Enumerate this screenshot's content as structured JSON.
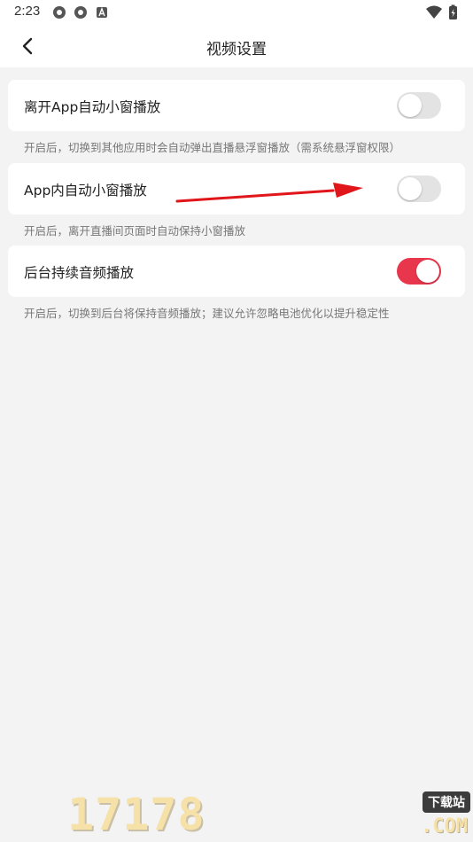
{
  "status_bar": {
    "time": "2:23"
  },
  "header": {
    "title": "视频设置"
  },
  "settings": [
    {
      "label": "离开App自动小窗播放",
      "enabled": false,
      "description": "开启后，切换到其他应用时会自动弹出直播悬浮窗播放（需系统悬浮窗权限）"
    },
    {
      "label": "App内自动小窗播放",
      "enabled": false,
      "description": "开启后，离开直播间页面时自动保持小窗播放"
    },
    {
      "label": "后台持续音频播放",
      "enabled": true,
      "description": "开启后，切换到后台将保持音频播放；建议允许忽略电池优化以提升稳定性"
    }
  ],
  "colors": {
    "toggle_on": "#e8374d",
    "toggle_off": "#e3e3e3",
    "annotation_arrow": "#e0161b"
  },
  "watermark": {
    "numbers": "17178",
    "badge": "下载站",
    "domain": ".COM"
  }
}
